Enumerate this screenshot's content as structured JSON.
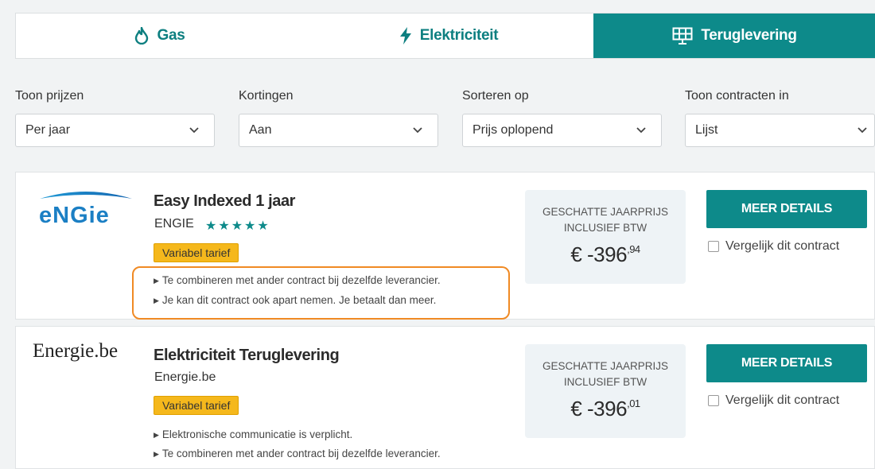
{
  "tabs": [
    {
      "label": "Gas",
      "icon": "flame-icon",
      "active": false
    },
    {
      "label": "Elektriciteit",
      "icon": "lightning-icon",
      "active": false
    },
    {
      "label": "Teruglevering",
      "icon": "solar-panel-icon",
      "active": true
    }
  ],
  "filters": [
    {
      "label": "Toon prijzen",
      "value": "Per jaar"
    },
    {
      "label": "Kortingen",
      "value": "Aan"
    },
    {
      "label": "Sorteren op",
      "value": "Prijs oplopend"
    },
    {
      "label": "Toon contracten in",
      "value": "Lijst"
    }
  ],
  "offers": [
    {
      "logo_text": "ENGIE",
      "title": "Easy Indexed 1 jaar",
      "supplier": "ENGIE",
      "rating": "★★★★★",
      "badge": "Variabel tarief",
      "notes": [
        "Te combineren met ander contract bij dezelfde leverancier.",
        "Je kan dit contract ook apart nemen. Je betaalt dan meer."
      ],
      "price_label_1": "GESCHATTE JAARPRIJS",
      "price_label_2": "INCLUSIEF BTW",
      "price_main": "€ -396",
      "price_cents": ",94",
      "details_label": "MEER DETAILS",
      "compare_label": "Vergelijk dit contract"
    },
    {
      "logo_text": "Energie.be",
      "title": "Elektriciteit Teruglevering",
      "supplier": "Energie.be",
      "badge": "Variabel tarief",
      "notes": [
        "Elektronische communicatie is verplicht.",
        "Te combineren met ander contract bij dezelfde leverancier."
      ],
      "price_label_1": "GESCHATTE JAARPRIJS",
      "price_label_2": "INCLUSIEF BTW",
      "price_main": "€ -396",
      "price_cents": ",01",
      "details_label": "MEER DETAILS",
      "compare_label": "Vergelijk dit contract"
    }
  ],
  "colors": {
    "brand_teal": "#0d8a8a",
    "badge_yellow": "#f5b81c",
    "highlight_orange": "#f08a24",
    "engie_blue": "#1b7fc4"
  }
}
